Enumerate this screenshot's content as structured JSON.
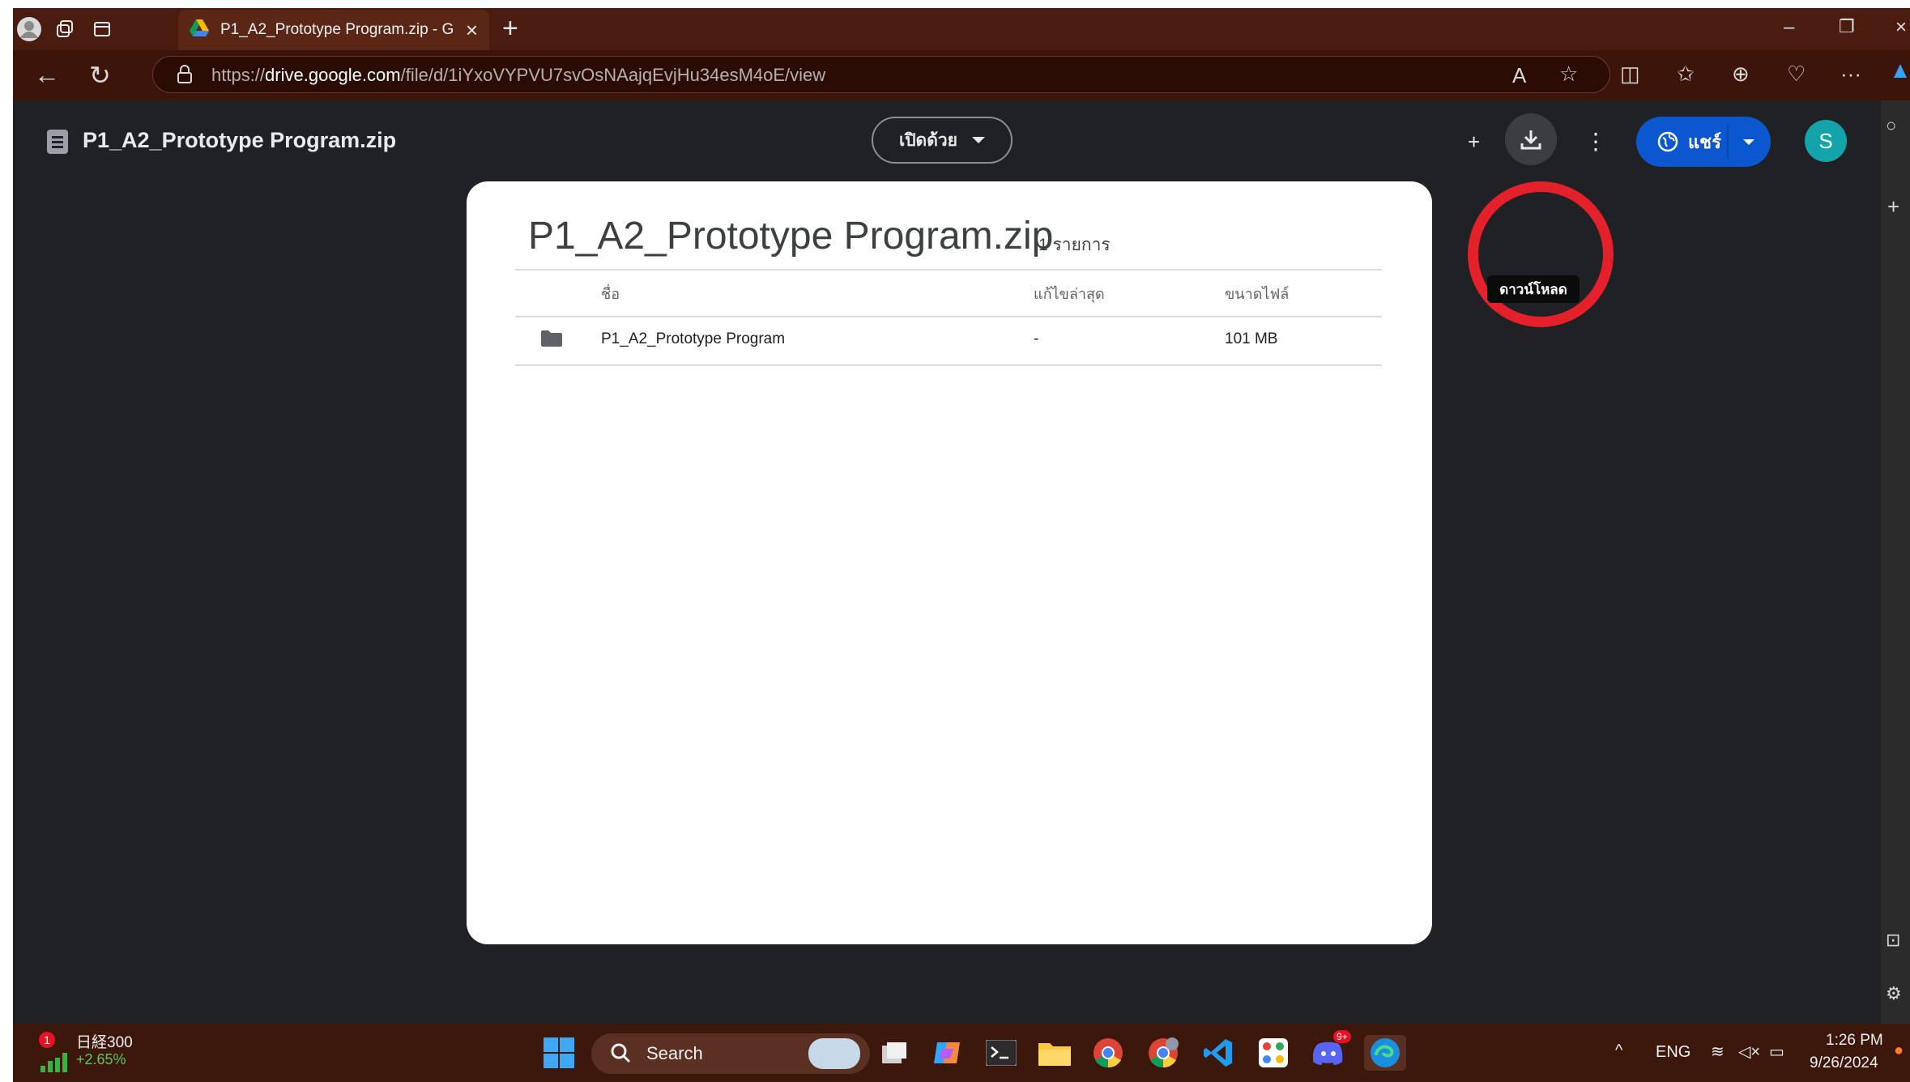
{
  "browser": {
    "tab_title": "P1_A2_Prototype Program.zip - G",
    "url_prefix": "https://",
    "url_host": "drive.google.com",
    "url_path": "/file/d/1iYxoVYPVU7svOsNAajqEvjHu34esM4oE/view"
  },
  "viewer": {
    "file_title": "P1_A2_Prototype Program.zip",
    "open_with_label": "เปิดด้วย",
    "download_tooltip": "ดาวน์โหลด",
    "share_label": "แชร์",
    "avatar_letter": "S"
  },
  "archive": {
    "title": "P1_A2_Prototype Program.zip",
    "item_count": "1 รายการ",
    "columns": [
      "ชื่อ",
      "แก้ไขล่าสุด",
      "ขนาดไฟล์"
    ],
    "rows": [
      {
        "name": "P1_A2_Prototype Program",
        "modified": "-",
        "size": "101 MB"
      }
    ]
  },
  "taskbar": {
    "stock_name": "日経300",
    "stock_change": "+2.65%",
    "stock_badge": "1",
    "search_label": "Search",
    "discord_badge": "9+",
    "language": "ENG",
    "time": "1:26 PM",
    "date": "9/26/2024"
  },
  "colors": {
    "tab_strip": "#4a1b0f",
    "toolbar": "#3d1409",
    "viewer_bg": "#202124",
    "share_blue": "#0b57d0",
    "highlight_red": "#e4212b",
    "avatar_teal": "#12a4a8"
  }
}
